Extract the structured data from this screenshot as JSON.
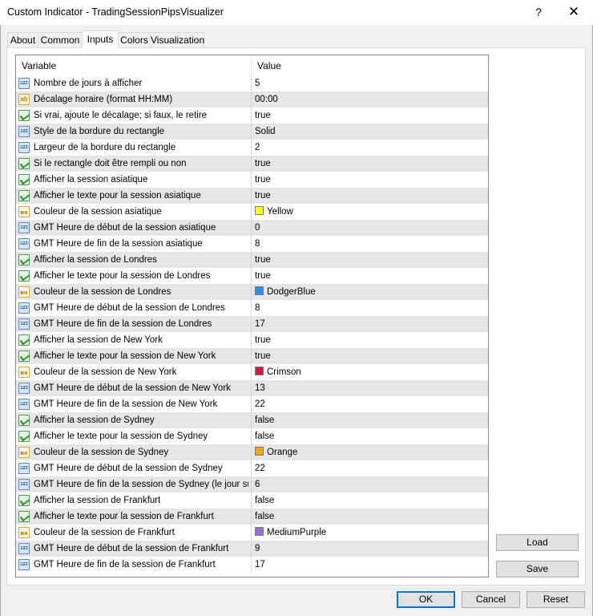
{
  "window": {
    "title": "Custom Indicator - TradingSessionPipsVisualizer",
    "help_label": "?",
    "close_label": "✕"
  },
  "tabs": [
    {
      "label": "About"
    },
    {
      "label": "Common"
    },
    {
      "label": "Inputs"
    },
    {
      "label": "Colors"
    },
    {
      "label": "Visualization"
    }
  ],
  "active_tab": "Inputs",
  "grid": {
    "col_variable": "Variable",
    "col_value": "Value",
    "rows": [
      {
        "icon": "int",
        "variable": "Nombre de jours à afficher",
        "value": "5"
      },
      {
        "icon": "str",
        "variable": "Décalage horaire (format HH:MM)",
        "value": "00:00"
      },
      {
        "icon": "bool",
        "variable": "Si vrai, ajoute le décalage; si faux, le retire",
        "value": "true"
      },
      {
        "icon": "int",
        "variable": "Style de la bordure du rectangle",
        "value": "Solid"
      },
      {
        "icon": "int",
        "variable": "Largeur de la bordure du rectangle",
        "value": "2"
      },
      {
        "icon": "bool",
        "variable": "Si le rectangle doit être rempli ou non",
        "value": "true"
      },
      {
        "icon": "bool",
        "variable": "Afficher la session asiatique",
        "value": "true"
      },
      {
        "icon": "bool",
        "variable": "Afficher le texte pour la session asiatique",
        "value": "true"
      },
      {
        "icon": "color",
        "variable": "Couleur de la session asiatique",
        "value": "Yellow",
        "color": "#ffff00"
      },
      {
        "icon": "int",
        "variable": "GMT Heure de début de la session asiatique",
        "value": "0"
      },
      {
        "icon": "int",
        "variable": "GMT Heure de fin de la session asiatique",
        "value": "8"
      },
      {
        "icon": "bool",
        "variable": "Afficher la session de Londres",
        "value": "true"
      },
      {
        "icon": "bool",
        "variable": "Afficher le texte pour la session de Londres",
        "value": "true"
      },
      {
        "icon": "color",
        "variable": "Couleur de la session de Londres",
        "value": "DodgerBlue",
        "color": "#1e90ff"
      },
      {
        "icon": "int",
        "variable": "GMT Heure de début de la session de Londres",
        "value": "8"
      },
      {
        "icon": "int",
        "variable": "GMT Heure de fin de la session de Londres",
        "value": "17"
      },
      {
        "icon": "bool",
        "variable": "Afficher la session de New York",
        "value": "true"
      },
      {
        "icon": "bool",
        "variable": "Afficher le texte pour la session de New York",
        "value": "true"
      },
      {
        "icon": "color",
        "variable": "Couleur de la session de New York",
        "value": "Crimson",
        "color": "#dc143c"
      },
      {
        "icon": "int",
        "variable": "GMT Heure de début de la session de New York",
        "value": "13"
      },
      {
        "icon": "int",
        "variable": "GMT Heure de fin de la session de New York",
        "value": "22"
      },
      {
        "icon": "bool",
        "variable": "Afficher la session de Sydney",
        "value": "false"
      },
      {
        "icon": "bool",
        "variable": "Afficher le texte pour la session de Sydney",
        "value": "false"
      },
      {
        "icon": "color",
        "variable": "Couleur de la session de Sydney",
        "value": "Orange",
        "color": "#ffa500"
      },
      {
        "icon": "int",
        "variable": "GMT Heure de début de la session de Sydney",
        "value": "22"
      },
      {
        "icon": "int",
        "variable": "GMT Heure de fin de la session de Sydney (le jour suiv...",
        "value": "6"
      },
      {
        "icon": "bool",
        "variable": "Afficher la session de Frankfurt",
        "value": "false"
      },
      {
        "icon": "bool",
        "variable": "Afficher le texte pour la session de Frankfurt",
        "value": "false"
      },
      {
        "icon": "color",
        "variable": "Couleur de la session de Frankfurt",
        "value": "MediumPurple",
        "color": "#9370db"
      },
      {
        "icon": "int",
        "variable": "GMT Heure de début de la session de Frankfurt",
        "value": "9"
      },
      {
        "icon": "int",
        "variable": "GMT Heure de fin de la session de Frankfurt",
        "value": "17"
      }
    ]
  },
  "buttons": {
    "load": "Load",
    "save": "Save",
    "ok": "OK",
    "cancel": "Cancel",
    "reset": "Reset"
  }
}
